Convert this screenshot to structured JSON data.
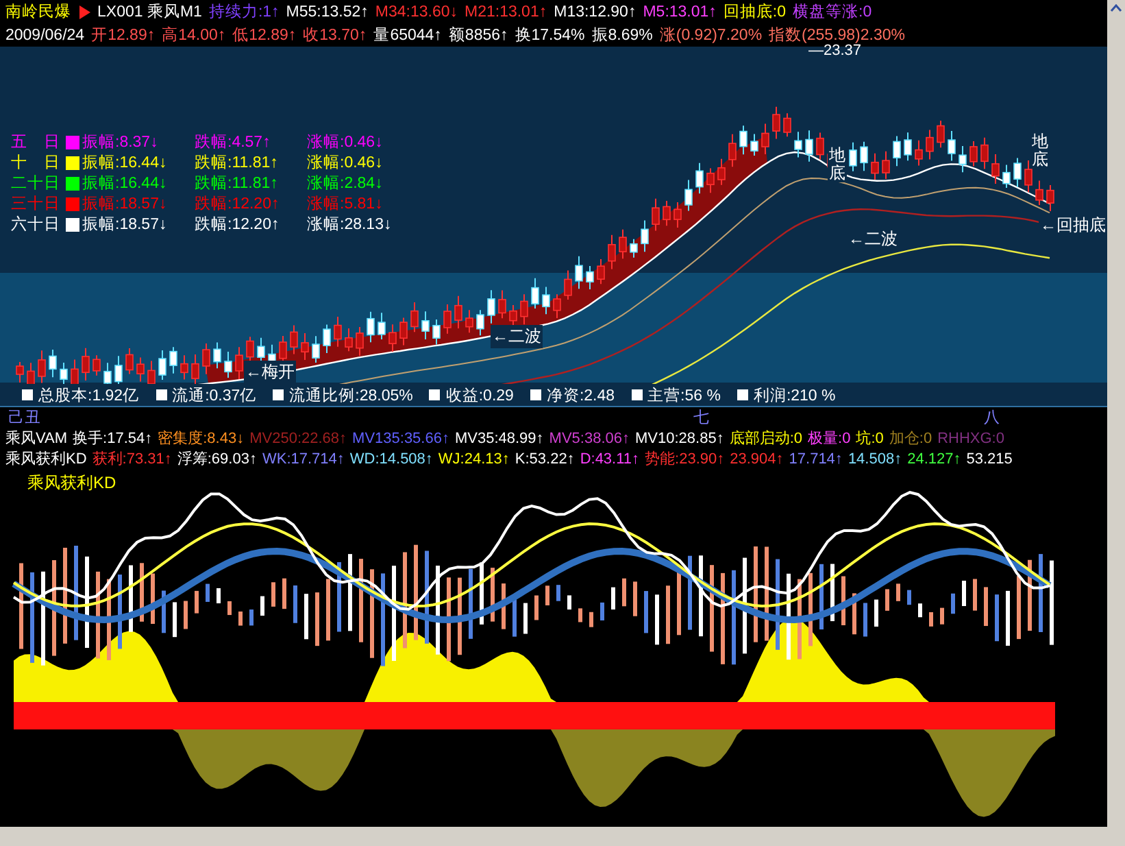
{
  "header_row": [
    {
      "text": "南岭民爆",
      "color": "#ffff00"
    },
    {
      "text": "LX001 乘风M1",
      "color": "#ffffff"
    },
    {
      "text": "持续力:1↑",
      "color": "#8040ff"
    },
    {
      "text": "M55:13.52↑",
      "color": "#ffffff"
    },
    {
      "text": "M34:13.60↓",
      "color": "#ff3030"
    },
    {
      "text": "M21:13.01↑",
      "color": "#ff3030"
    },
    {
      "text": "M13:12.90↑",
      "color": "#ffffff"
    },
    {
      "text": "M5:13.01↑",
      "color": "#ff40ff"
    },
    {
      "text": "回抽底:0",
      "color": "#ffff00"
    },
    {
      "text": "横盘等涨:0",
      "color": "#c040ff"
    }
  ],
  "quote_row": [
    {
      "text": "2009/06/24",
      "color": "#ffffff"
    },
    {
      "text": "开12.89↑",
      "color": "#ff5050"
    },
    {
      "text": "高14.00↑",
      "color": "#ff5050"
    },
    {
      "text": "低12.89↑",
      "color": "#ff5050"
    },
    {
      "text": "收13.70↑",
      "color": "#ff5050"
    },
    {
      "text": "量65044↑",
      "color": "#ffffff"
    },
    {
      "text": "额8856↑",
      "color": "#ffffff"
    },
    {
      "text": "换17.54%",
      "color": "#ffffff"
    },
    {
      "text": "振8.69%",
      "color": "#ffffff"
    },
    {
      "text": "涨(0.92)7.20%",
      "color": "#ff7060"
    },
    {
      "text": "指数(255.98)2.30%",
      "color": "#ff7060"
    }
  ],
  "price_label": "—23.37",
  "range_stats": [
    {
      "label": "五　日",
      "color": "#ff00ff",
      "stats": [
        "振幅:8.37↓",
        "跌幅:4.57↑",
        "涨幅:0.46↓"
      ]
    },
    {
      "label": "十　日",
      "color": "#ffff00",
      "stats": [
        "振幅:16.44↓",
        "跌幅:11.81↑",
        "涨幅:0.46↓"
      ]
    },
    {
      "label": "二十日",
      "color": "#00ff00",
      "stats": [
        "振幅:16.44↓",
        "跌幅:11.81↑",
        "涨幅:2.84↓"
      ]
    },
    {
      "label": "三十日",
      "color": "#ff0000",
      "stats": [
        "振幅:18.57↓",
        "跌幅:12.20↑",
        "涨幅:5.81↓"
      ]
    },
    {
      "label": "六十日",
      "color": "#ffffff",
      "stats": [
        "振幅:18.57↓",
        "跌幅:12.20↑",
        "涨幅:28.13↓"
      ]
    }
  ],
  "annotations": [
    {
      "text": "地底",
      "kind": "vertical"
    },
    {
      "text": "地底",
      "kind": "vertical"
    },
    {
      "text": "←二波",
      "kind": "arrow"
    },
    {
      "text": "←回抽底",
      "kind": "arrow"
    },
    {
      "text": "←二波",
      "kind": "arrow"
    },
    {
      "text": "←梅开",
      "kind": "arrow"
    }
  ],
  "fundamentals": [
    "总股本:1.92亿",
    "流通:0.37亿",
    "流通比例:28.05%",
    "收益:0.29",
    "净资:2.48",
    "主营:56 %",
    "利润:210 %"
  ],
  "timeline": [
    "己丑",
    "七",
    "八"
  ],
  "vam_row": [
    {
      "text": "乘风VAM",
      "color": "#ffffff"
    },
    {
      "text": "换手:17.54↑",
      "color": "#ffffff"
    },
    {
      "text": "密集度:8.43↓",
      "color": "#ff9020"
    },
    {
      "text": "MV250:22.68↑",
      "color": "#a02020"
    },
    {
      "text": "MV135:35.66↑",
      "color": "#6060ff"
    },
    {
      "text": "MV35:48.99↑",
      "color": "#ffffff"
    },
    {
      "text": "MV5:38.06↑",
      "color": "#d040d0"
    },
    {
      "text": "MV10:28.85↑",
      "color": "#ffffff"
    },
    {
      "text": "底部启动:0",
      "color": "#ffff00"
    },
    {
      "text": "极量:0",
      "color": "#ff40ff"
    },
    {
      "text": "坑:0",
      "color": "#ffff00"
    },
    {
      "text": "加仓:0",
      "color": "#a08020"
    },
    {
      "text": "RHHXG:0",
      "color": "#803080"
    }
  ],
  "kd_row": [
    {
      "text": "乘风获利KD",
      "color": "#ffffff"
    },
    {
      "text": "获利:73.31↑",
      "color": "#ff3030"
    },
    {
      "text": "浮筹:69.03↑",
      "color": "#ffffff"
    },
    {
      "text": "WK:17.714↑",
      "color": "#8080ff"
    },
    {
      "text": "WD:14.508↑",
      "color": "#80e0ff"
    },
    {
      "text": "WJ:24.13↑",
      "color": "#ffff00"
    },
    {
      "text": "K:53.22↑",
      "color": "#ffffff"
    },
    {
      "text": "D:43.11↑",
      "color": "#ff40ff"
    },
    {
      "text": "势能:23.90↑",
      "color": "#ff3030"
    },
    {
      "text": "23.904↑",
      "color": "#ff3030"
    },
    {
      "text": "17.714↑",
      "color": "#8080ff"
    },
    {
      "text": "14.508↑",
      "color": "#80e0ff"
    },
    {
      "text": "24.127↑",
      "color": "#40ff40"
    },
    {
      "text": "53.215",
      "color": "#ffffff"
    }
  ],
  "kd_title": "乘风获利KD"
}
